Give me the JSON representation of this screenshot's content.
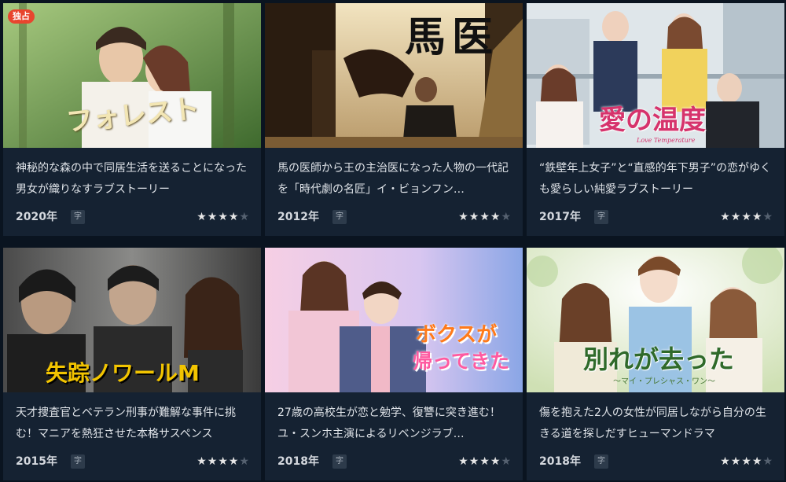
{
  "cards": [
    {
      "title_art": "フォレスト",
      "badge": "独占",
      "description": "神秘的な森の中で同居生活を送ることになった男女が織りなすラブストーリー",
      "year": "2020年",
      "subtitle_tag": "字",
      "rating": 4,
      "rating_max": 5,
      "colors": {
        "bg1": "#8fb56a",
        "bg2": "#3f6a2e",
        "art": "#f3e6b4"
      }
    },
    {
      "title_art": "馬医",
      "description": "馬の医師から王の主治医になった人物の一代記を「時代劇の名匠」イ・ビョンフン…",
      "year": "2012年",
      "subtitle_tag": "字",
      "rating": 4,
      "rating_max": 5,
      "colors": {
        "bg1": "#e9d9b0",
        "bg2": "#3a2a1a",
        "art": "#111111"
      }
    },
    {
      "title_art": "愛の温度",
      "title_sub": "Love Temperature",
      "description": "“鉄壁年上女子”と“直感的年下男子”の恋がゆくも愛らしい純愛ラブストーリー",
      "year": "2017年",
      "subtitle_tag": "字",
      "rating": 4,
      "rating_max": 5,
      "colors": {
        "bg1": "#dfe6ea",
        "bg2": "#9fb3bf",
        "art": "#d6336c"
      }
    },
    {
      "title_art": "失踪ノワールM",
      "description": "天才捜査官とベテラン刑事が難解な事件に挑む！マニアを熱狂させた本格サスペンス",
      "year": "2015年",
      "subtitle_tag": "字",
      "rating": 4,
      "rating_max": 5,
      "colors": {
        "bg1": "#6b6b6b",
        "bg2": "#1f1f1f",
        "art": "#f2c400"
      }
    },
    {
      "title_art": "ボクスが帰ってきた",
      "title_line1": "ボクスが",
      "title_line2": "帰ってきた",
      "description": "27歳の高校生が恋と勉学、復讐に突き進む！ユ・スンホ主演によるリベンジラブ…",
      "year": "2018年",
      "subtitle_tag": "字",
      "rating": 4,
      "rating_max": 5,
      "colors": {
        "bg1": "#f3c9e0",
        "bg2": "#8aa6e6",
        "art": "#ff7a1a"
      }
    },
    {
      "title_art": "別れが去った",
      "title_sub": "〜マイ・プレシャス・ワン〜",
      "description": "傷を抱えた2人の女性が同居しながら自分の生きる道を探しだすヒューマンドラマ",
      "year": "2018年",
      "subtitle_tag": "字",
      "rating": 4,
      "rating_max": 5,
      "colors": {
        "bg1": "#f3f6e6",
        "bg2": "#cfe0b4",
        "art": "#2f6a2a"
      }
    }
  ]
}
